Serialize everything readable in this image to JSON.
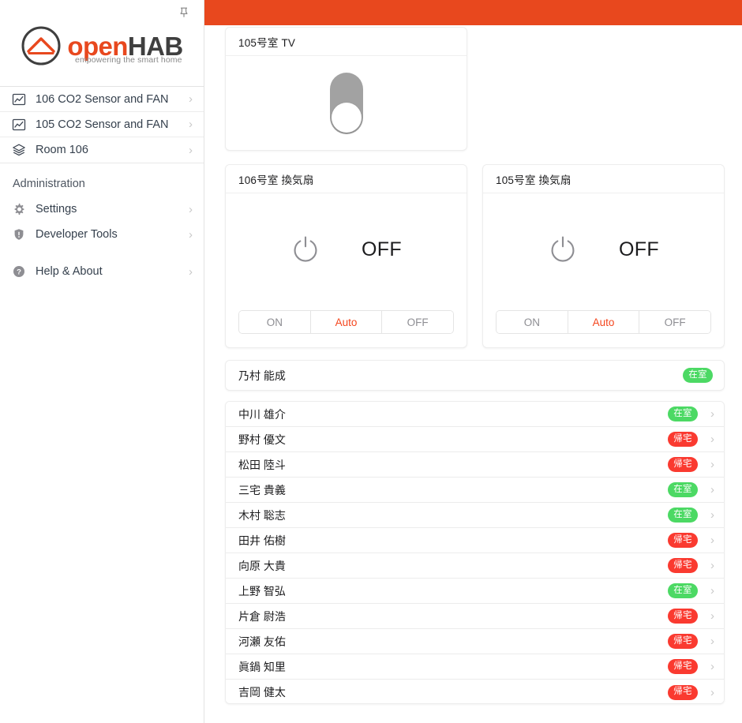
{
  "brand": {
    "logo_open": "open",
    "logo_hab": "HAB",
    "tagline": "empowering the smart home",
    "pin_icon": "pin-icon",
    "accent_color": "#e8481e"
  },
  "topbar": {
    "color": "#e8481e"
  },
  "sidebar": {
    "pages": [
      {
        "icon": "chart-frame-icon",
        "label": "106 CO2 Sensor and FAN",
        "chevron": "›"
      },
      {
        "icon": "chart-frame-icon",
        "label": "105 CO2 Sensor and FAN",
        "chevron": "›"
      },
      {
        "icon": "layers-icon",
        "label": "Room 106",
        "chevron": "›"
      }
    ],
    "administration": {
      "title": "Administration",
      "items": [
        {
          "icon": "gear-icon",
          "label": "Settings",
          "chevron": "›"
        },
        {
          "icon": "shield-alert-icon",
          "label": "Developer Tools",
          "chevron": "›"
        },
        {
          "icon": "question-circle-icon",
          "label": "Help & About",
          "chevron": "›"
        }
      ]
    }
  },
  "main": {
    "tv_card": {
      "title": "105号室 TV",
      "toggle_state": "OFF",
      "toggle_icon": "vertical-toggle-switch"
    },
    "fan_cards": [
      {
        "title": "106号室 換気扇",
        "state": "OFF",
        "power_icon": "power-icon",
        "segments": [
          {
            "label": "ON",
            "active": false
          },
          {
            "label": "Auto",
            "active": true
          },
          {
            "label": "OFF",
            "active": false
          }
        ]
      },
      {
        "title": "105号室 換気扇",
        "state": "OFF",
        "power_icon": "power-icon",
        "segments": [
          {
            "label": "ON",
            "active": false
          },
          {
            "label": "Auto",
            "active": true
          },
          {
            "label": "OFF",
            "active": false
          }
        ]
      }
    ],
    "person_featured": {
      "name": "乃村 能成",
      "status": "在室",
      "status_type": "present"
    },
    "person_list": {
      "chevron": "›",
      "rows": [
        {
          "name": "中川 雄介",
          "status": "在室",
          "status_type": "present"
        },
        {
          "name": "野村 優文",
          "status": "帰宅",
          "status_type": "away"
        },
        {
          "name": "松田 陸斗",
          "status": "帰宅",
          "status_type": "away"
        },
        {
          "name": "三宅 貴義",
          "status": "在室",
          "status_type": "present"
        },
        {
          "name": "木村 聡志",
          "status": "在室",
          "status_type": "present"
        },
        {
          "name": "田井 佑樹",
          "status": "帰宅",
          "status_type": "away"
        },
        {
          "name": "向原 大貴",
          "status": "帰宅",
          "status_type": "away"
        },
        {
          "name": "上野 智弘",
          "status": "在室",
          "status_type": "present"
        },
        {
          "name": "片倉 尉浩",
          "status": "帰宅",
          "status_type": "away"
        },
        {
          "name": "河瀬 友佑",
          "status": "帰宅",
          "status_type": "away"
        },
        {
          "name": "眞鍋 知里",
          "status": "帰宅",
          "status_type": "away"
        },
        {
          "name": "吉岡 健太",
          "status": "帰宅",
          "status_type": "away"
        }
      ]
    }
  },
  "colors": {
    "accent": "#e8481e",
    "present_badge": "#4cd964",
    "away_badge": "#fa3a30",
    "segment_active": "#f4461e",
    "toggle_track": "#a2a2a2"
  }
}
